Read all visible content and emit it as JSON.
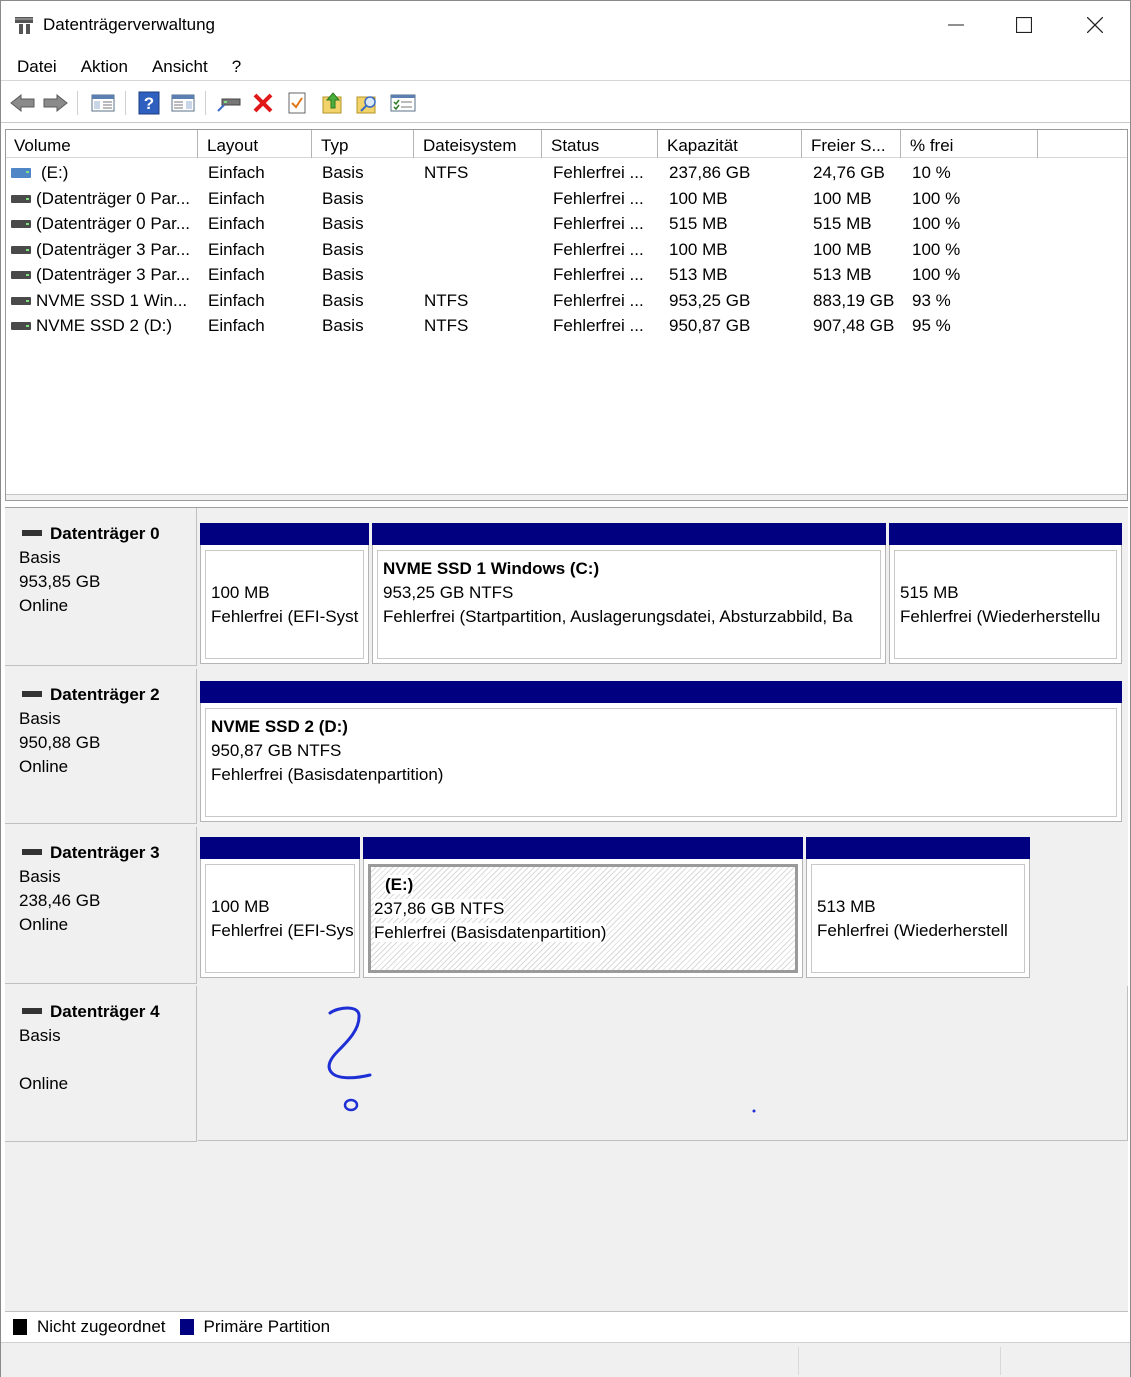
{
  "window": {
    "title": "Datenträgerverwaltung"
  },
  "menu": [
    "Datei",
    "Aktion",
    "Ansicht",
    "?"
  ],
  "toolbar": {
    "buttons": [
      "back-arrow-icon",
      "forward-arrow-icon",
      "show-hide-console-tree-icon",
      "help-icon",
      "show-action-pane-icon",
      "connect-drive-icon",
      "delete-icon",
      "properties-icon",
      "export-icon",
      "find-icon",
      "checklist-icon"
    ]
  },
  "columns": [
    "Volume",
    "Layout",
    "Typ",
    "Dateisystem",
    "Status",
    "Kapazität",
    "Freier S...",
    "% frei"
  ],
  "volumes": [
    {
      "volume": "(E:)",
      "layout": "Einfach",
      "typ": "Basis",
      "fs": "NTFS",
      "status": "Fehlerfrei ...",
      "cap": "237,86 GB",
      "free": "24,76 GB",
      "pct": "10 %"
    },
    {
      "volume": "(Datenträger 0 Par...",
      "layout": "Einfach",
      "typ": "Basis",
      "fs": "",
      "status": "Fehlerfrei ...",
      "cap": "100 MB",
      "free": "100 MB",
      "pct": "100 %"
    },
    {
      "volume": "(Datenträger 0 Par...",
      "layout": "Einfach",
      "typ": "Basis",
      "fs": "",
      "status": "Fehlerfrei ...",
      "cap": "515 MB",
      "free": "515 MB",
      "pct": "100 %"
    },
    {
      "volume": "(Datenträger 3 Par...",
      "layout": "Einfach",
      "typ": "Basis",
      "fs": "",
      "status": "Fehlerfrei ...",
      "cap": "100 MB",
      "free": "100 MB",
      "pct": "100 %"
    },
    {
      "volume": "(Datenträger 3 Par...",
      "layout": "Einfach",
      "typ": "Basis",
      "fs": "",
      "status": "Fehlerfrei ...",
      "cap": "513 MB",
      "free": "513 MB",
      "pct": "100 %"
    },
    {
      "volume": "NVME SSD 1 Win...",
      "layout": "Einfach",
      "typ": "Basis",
      "fs": "NTFS",
      "status": "Fehlerfrei ...",
      "cap": "953,25 GB",
      "free": "883,19 GB",
      "pct": "93 %"
    },
    {
      "volume": "NVME SSD 2 (D:)",
      "layout": "Einfach",
      "typ": "Basis",
      "fs": "NTFS",
      "status": "Fehlerfrei ...",
      "cap": "950,87 GB",
      "free": "907,48 GB",
      "pct": "95 %"
    }
  ],
  "disks": [
    {
      "name": "Datenträger 0",
      "type": "Basis",
      "size": "953,85 GB",
      "state": "Online",
      "partitions": [
        {
          "name": "",
          "line1": "100 MB",
          "line2": "Fehlerfrei (EFI-Syst"
        },
        {
          "name": "NVME SSD 1 Windows  (C:)",
          "line1": "953,25 GB NTFS",
          "line2": "Fehlerfrei (Startpartition, Auslagerungsdatei, Absturzabbild, Ba"
        },
        {
          "name": "",
          "line1": "515 MB",
          "line2": "Fehlerfrei (Wiederherstellu"
        }
      ]
    },
    {
      "name": "Datenträger 2",
      "type": "Basis",
      "size": "950,88 GB",
      "state": "Online",
      "partitions": [
        {
          "name": "NVME SSD 2  (D:)",
          "line1": "950,87 GB NTFS",
          "line2": "Fehlerfrei (Basisdatenpartition)"
        }
      ]
    },
    {
      "name": "Datenträger 3",
      "type": "Basis",
      "size": "238,46 GB",
      "state": "Online",
      "partitions": [
        {
          "name": "",
          "line1": "100 MB",
          "line2": "Fehlerfrei (EFI-Sys"
        },
        {
          "name": "(E:)",
          "line1": "237,86 GB NTFS",
          "line2": "Fehlerfrei (Basisdatenpartition)"
        },
        {
          "name": "",
          "line1": "513 MB",
          "line2": "Fehlerfrei (Wiederherstell"
        }
      ]
    },
    {
      "name": "Datenträger 4",
      "type": "Basis",
      "size": "",
      "state": "Online"
    }
  ],
  "legend": [
    {
      "label": "Nicht zugeordnet",
      "color": "#000000"
    },
    {
      "label": "Primäre Partition",
      "color": "#000080"
    }
  ],
  "colors": {
    "primary_partition": "#000080",
    "unallocated": "#000000",
    "annotation": "#1f2fd6"
  }
}
